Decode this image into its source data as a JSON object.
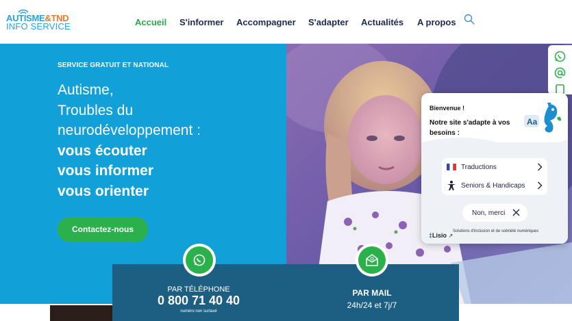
{
  "logo": {
    "line1_a": "AUTISME",
    "line1_b": "&TND",
    "line2": "INFO SERVICE"
  },
  "nav": {
    "items": [
      {
        "label": "Accueil",
        "active": true
      },
      {
        "label": "S'informer"
      },
      {
        "label": "Accompagner"
      },
      {
        "label": "S'adapter"
      },
      {
        "label": "Actualités"
      },
      {
        "label": "A propos"
      }
    ],
    "search_icon": "search-icon"
  },
  "hero": {
    "eyebrow": "SERVICE GRATUIT ET NATIONAL",
    "title_lines": [
      "Autisme,",
      "Troubles du",
      "neurodéveloppement :"
    ],
    "title_bold_lines": [
      "vous écouter",
      "vous informer",
      "vous orienter"
    ],
    "cta_label": "Contactez-nous",
    "colors": {
      "blue": "#11a0d8",
      "green": "#2bb14b"
    }
  },
  "side_tabs": [
    "whatsapp-icon",
    "at-icon",
    "document-icon"
  ],
  "lisio": {
    "welcome": "Bienvenue !",
    "adapt_text": "Notre site s'adapte à vos besoins :",
    "options": [
      {
        "label": "Traductions",
        "icon": "flag-fr-icon"
      },
      {
        "label": "Seniors & Handicaps",
        "icon": "accessibility-icon"
      }
    ],
    "decline_label": "Non, merci",
    "brand": "Lisio",
    "brand_tagline": "Solutions d'inclusion et de sobriété numériques"
  },
  "contact": {
    "phone": {
      "label": "PAR TÉLÉPHONE",
      "number": "0 800 71 40 40",
      "note": "numéro non surtaxé"
    },
    "mail": {
      "label": "PAR MAIL",
      "hours": "24h/24 et 7j/7"
    }
  }
}
